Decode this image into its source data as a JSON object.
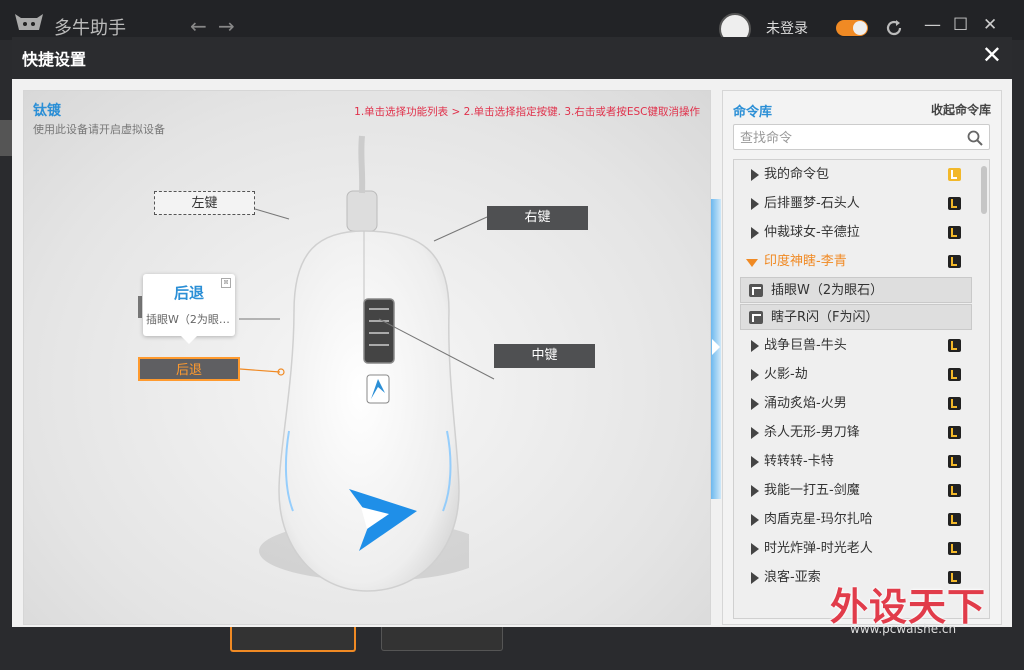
{
  "app": {
    "title": "多牛助手",
    "nav_back": "←",
    "nav_forward": "→",
    "login_status": "未登录",
    "win_min": "—",
    "win_max": "☐",
    "win_close": "✕"
  },
  "dialog": {
    "title": "快捷设置",
    "close": "✕"
  },
  "device": {
    "name": "钛镀",
    "subtitle": "使用此设备请开启虚拟设备",
    "steps": "1.单击选择功能列表 > 2.单击选择指定按键. 3.右击或者按ESC键取消操作",
    "buttons": {
      "left": "左键",
      "right": "右键",
      "middle": "中键",
      "back": "后退"
    },
    "callout": {
      "title": "后退",
      "text": "插眼W（2为眼…",
      "close": "⊠"
    }
  },
  "library": {
    "title": "命令库",
    "collect": "收起命令库",
    "search_placeholder": "查找命令",
    "items": [
      {
        "label": "我的命令包",
        "badge": "gold"
      },
      {
        "label": "后排噩梦-石头人"
      },
      {
        "label": "仲裁球女-辛德拉"
      },
      {
        "label": "印度神瞎-李青",
        "open": true,
        "children": [
          "插眼W（2为眼石）",
          "瞎子R闪（F为闪）"
        ]
      },
      {
        "label": "战争巨兽-牛头"
      },
      {
        "label": "火影-劫"
      },
      {
        "label": "涌动炙焰-火男"
      },
      {
        "label": "杀人无形-男刀锋"
      },
      {
        "label": "转转转-卡特"
      },
      {
        "label": "我能一打五-剑魔"
      },
      {
        "label": "肉盾克星-玛尔扎哈"
      },
      {
        "label": "时光炸弹-时光老人"
      },
      {
        "label": "浪客-亚索"
      }
    ]
  },
  "watermark": {
    "text": "外设天下",
    "url": "www.pcwaishe.cn"
  },
  "colors": {
    "accent_blue": "#2b8fd6",
    "accent_orange": "#f08a24",
    "step_red": "#e0314b"
  }
}
